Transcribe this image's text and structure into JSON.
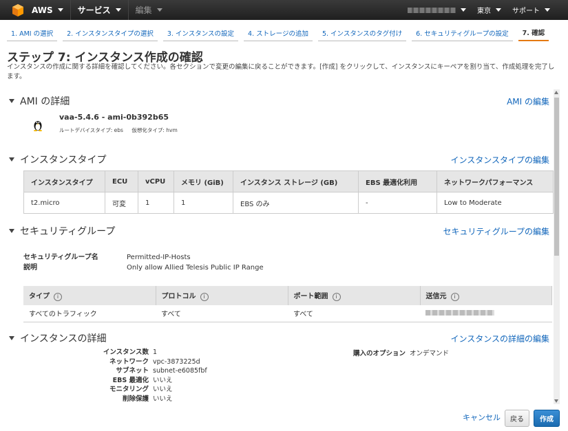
{
  "nav": {
    "brand": "AWS",
    "services": "サービス",
    "edit": "編集",
    "region": "東京",
    "support": "サポート"
  },
  "tabs": [
    "1. AMI の選択",
    "2. インスタンスタイプの選択",
    "3. インスタンスの設定",
    "4. ストレージの追加",
    "5. インスタンスのタグ付け",
    "6. セキュリティグループの設定",
    "7. 確認"
  ],
  "page": {
    "title": "ステップ 7: インスタンス作成の確認",
    "desc": "インスタンスの作成に関する詳細を確認してください。各セクションで変更の編集に戻ることができます。[作成] をクリックして、インスタンスにキーペアを割り当て、作成処理を完了します。"
  },
  "ami": {
    "heading": "AMI の詳細",
    "edit": "AMI の編集",
    "name": "vaa-5.4.6 - ami-0b392b65",
    "root_device": "ルートデバイスタイプ: ebs",
    "virtualization": "仮想化タイプ: hvm"
  },
  "instance_type": {
    "heading": "インスタンスタイプ",
    "edit": "インスタンスタイプの編集",
    "columns": [
      "インスタンスタイプ",
      "ECU",
      "vCPU",
      "メモリ (GiB)",
      "インスタンス ストレージ (GB)",
      "EBS 最適化利用",
      "ネットワークパフォーマンス"
    ],
    "row": [
      "t2.micro",
      "可変",
      "1",
      "1",
      "EBS のみ",
      "-",
      "Low to Moderate"
    ]
  },
  "security_group": {
    "heading": "セキュリティグループ",
    "edit": "セキュリティグループの編集",
    "name_label": "セキュリティグループ名",
    "name_value": "Permitted-IP-Hosts",
    "desc_label": "説明",
    "desc_value": "Only allow Allied Telesis Public IP Range",
    "rule_columns": [
      "タイプ",
      "プロトコル",
      "ポート範囲",
      "送信元"
    ],
    "rule_row": [
      "すべてのトラフィック",
      "すべて",
      "すべて"
    ]
  },
  "instance_details": {
    "heading": "インスタンスの詳細",
    "edit": "インスタンスの詳細の編集",
    "rows": [
      {
        "k": "インスタンス数",
        "v": "1"
      },
      {
        "k": "ネットワーク",
        "v": "vpc-3873225d"
      },
      {
        "k": "サブネット",
        "v": "subnet-e6085fbf"
      },
      {
        "k": "EBS 最適化",
        "v": "いいえ"
      },
      {
        "k": "モニタリング",
        "v": "いいえ"
      },
      {
        "k": "削除保護",
        "v": "いいえ"
      }
    ],
    "purchase_label": "購入のオプション",
    "purchase_value": "オンデマンド"
  },
  "footer": {
    "cancel": "キャンセル",
    "back": "戻る",
    "create": "作成"
  },
  "colors": {
    "link": "#1166bb",
    "active_tab": "#e47911",
    "primary_button": "#1a6bb0"
  }
}
